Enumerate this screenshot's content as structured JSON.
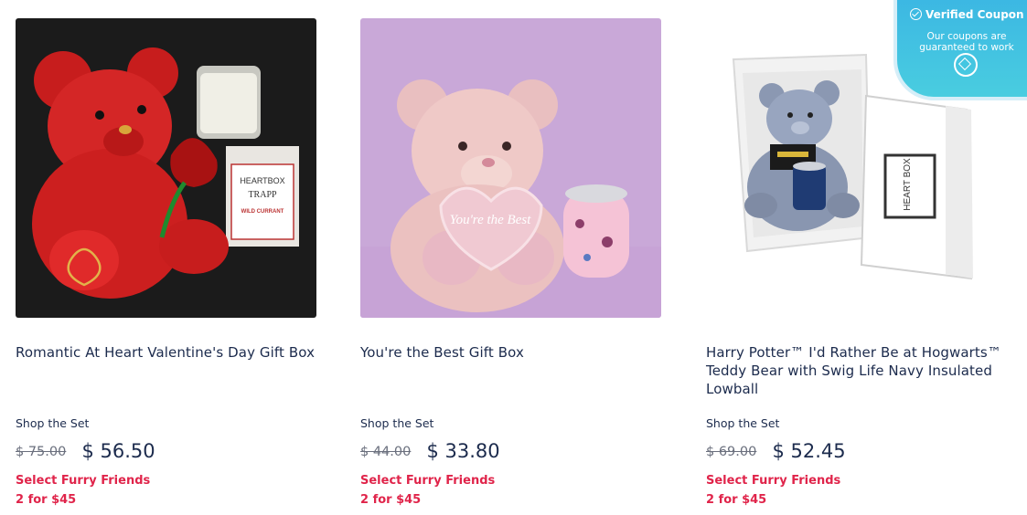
{
  "coupon": {
    "title": "Verified Coupon",
    "subtitle": "Our coupons are guaranteed to work",
    "check_icon": "check-circle-icon",
    "logo_icon": "coupon-logo-icon"
  },
  "products": [
    {
      "title": "Romantic At Heart Valentine's Day Gift Box",
      "shop_label": "Shop the Set",
      "old_price": "$ 75.00",
      "new_price": "$ 56.50",
      "promo_line1": "Select Furry Friends",
      "promo_line2": "2 for $45",
      "image": "red-rose-teddy-bear-with-candle"
    },
    {
      "title": "You're the Best Gift Box",
      "shop_label": "Shop the Set",
      "old_price": "$ 44.00",
      "new_price": "$ 33.80",
      "promo_line1": "Select Furry Friends",
      "promo_line2": "2 for $45",
      "image": "pink-teddy-bear-with-tumbler"
    },
    {
      "title": "Harry Potter™ I'd Rather Be at Hogwarts™ Teddy Bear with Swig Life Navy Insulated Lowball",
      "shop_label": "Shop the Set",
      "old_price": "$ 69.00",
      "new_price": "$ 52.45",
      "promo_line1": "Select Furry Friends",
      "promo_line2": "2 for $45",
      "image": "gray-teddy-bear-in-gift-box"
    }
  ],
  "image_text": {
    "candle_brand": "HEARTBOX",
    "candle_name": "TRAPP",
    "candle_scent": "WILD CURRANT",
    "heart_text": "You're the Best",
    "box_logo": "HEART BOX"
  },
  "colors": {
    "promo": "#e0244a",
    "title": "#1c2b4d",
    "coupon": "#3bb6e3"
  }
}
